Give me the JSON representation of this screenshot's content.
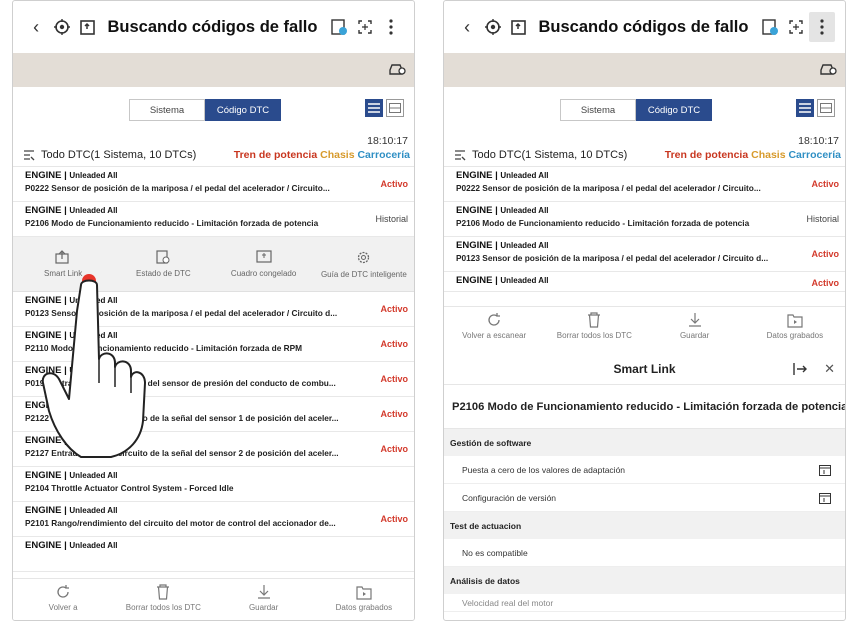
{
  "colors": {
    "accent": "#2a4b8d",
    "active": "#d33a2c",
    "tren": "#c8361f",
    "chasis": "#d79a2b",
    "carroceria": "#2f8fc4",
    "strip": "#e3ddd6"
  },
  "header": {
    "title": "Buscando códigos de fallo",
    "icons": [
      "back-icon",
      "scan-icon",
      "export-icon",
      "vci-icon",
      "fullscreen-icon",
      "more-icon"
    ]
  },
  "tabs": {
    "system": "Sistema",
    "dtc": "Código DTC"
  },
  "summary": {
    "time": "18:10:17",
    "all_label": "Todo DTC(1 Sistema, 10 DTCs)",
    "filter_tren": "Tren de potencia",
    "filter_chasis": "Chasis",
    "filter_carroceria": "Carrocería"
  },
  "dtcs": [
    {
      "module": "ENGINE",
      "sub": "Unleaded All",
      "desc": "P0222 Sensor de posición de la mariposa / el pedal del acelerador / Circuito...",
      "status": "Activo"
    },
    {
      "module": "ENGINE",
      "sub": "Unleaded All",
      "desc": "P2106 Modo de Funcionamiento reducido - Limitación forzada de potencia",
      "status": "Historial"
    },
    {
      "module": "ENGINE",
      "sub": "Unleaded All",
      "desc": "P0123 Sensor de posición de la mariposa / el pedal del acelerador / Circuito d...",
      "status": "Activo"
    },
    {
      "module": "ENGINE",
      "sub": "Unleaded All",
      "desc": "P2110 Modo de Funcionamiento reducido - Limitación forzada de RPM",
      "status": "Activo"
    },
    {
      "module": "ENGINE",
      "sub": "Unleaded All",
      "desc": "P0193 Entrada alta del circuito del sensor de presión del conducto de combu...",
      "status": "Activo"
    },
    {
      "module": "ENGINE",
      "sub": "Unleaded All",
      "desc": "P2122 Entrada baja del circuito de la señal del sensor 1 de posición del aceler...",
      "status": "Activo"
    },
    {
      "module": "ENGINE",
      "sub": "Unleaded All",
      "desc": "P2127 Entrada baja del circuito de la señal del sensor 2 de posición del aceler...",
      "status": "Activo"
    },
    {
      "module": "ENGINE",
      "sub": "Unleaded All",
      "desc": "P2104 Throttle Actuator Control System - Forced Idle",
      "status": ""
    },
    {
      "module": "ENGINE",
      "sub": "Unleaded All",
      "desc": "P2101 Rango/rendimiento del circuito del motor de control del accionador de...",
      "status": "Activo"
    },
    {
      "module": "ENGINE",
      "sub": "Unleaded All",
      "desc": "",
      "status": ""
    }
  ],
  "actions": {
    "smart_link": "Smart Link",
    "estado": "Estado de DTC",
    "cuadro": "Cuadro congelado",
    "guia": "Guía de DTC inteligente"
  },
  "bottom": {
    "left": {
      "volver": "Volver a",
      "borrar": "Borrar todos los DTC",
      "guardar": "Guardar",
      "datos": "Datos grabados"
    },
    "right": {
      "volver": "Volver a escanear",
      "borrar": "Borrar todos los DTC",
      "guardar": "Guardar",
      "datos": "Datos grabados"
    }
  },
  "smart_link": {
    "title": "Smart Link",
    "dtc": "P2106 Modo de Funcionamiento reducido - Limitación forzada de potencia",
    "sections": {
      "software": "Gestión de software",
      "software_items": [
        "Puesta a cero de los valores de adaptación",
        "Configuración de versión"
      ],
      "actuacion": "Test de actuacion",
      "actuacion_items": [
        "No es compatible"
      ],
      "analisis": "Análisis de datos",
      "analisis_items": [
        "Velocidad real del motor"
      ]
    }
  }
}
